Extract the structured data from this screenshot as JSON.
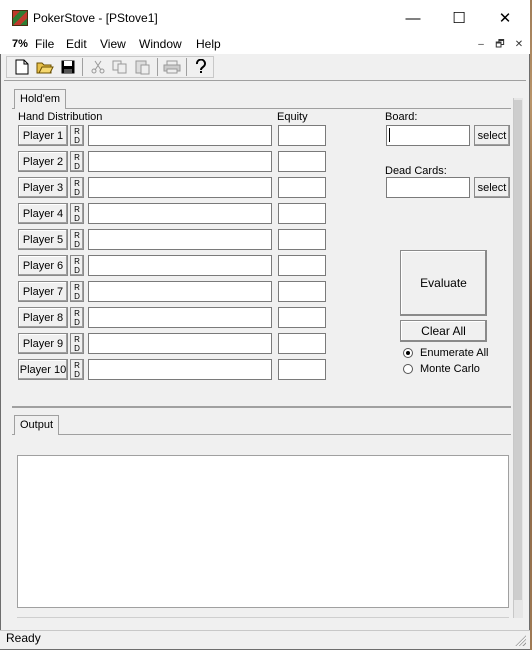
{
  "window": {
    "title": "PokerStove - [PStove1]",
    "minimize_glyph": "—",
    "maximize_glyph": "☐",
    "close_glyph": "✕"
  },
  "menu": {
    "zoom": "7%",
    "items": [
      "File",
      "Edit",
      "View",
      "Window",
      "Help"
    ],
    "mdi_min": "–",
    "mdi_restore": "🗗",
    "mdi_close": "✕"
  },
  "toolbar": {
    "icons": [
      "new-file-icon",
      "open-folder-icon",
      "save-icon",
      "cut-icon",
      "copy-icon",
      "paste-icon",
      "print-icon",
      "help-icon"
    ]
  },
  "tabs": {
    "holdem": "Hold'em",
    "output": "Output"
  },
  "labels": {
    "hand_distribution": "Hand Distribution",
    "equity": "Equity",
    "board": "Board:",
    "dead_cards": "Dead Cards:"
  },
  "players": [
    {
      "label": "Player 1",
      "rd": "R\nD",
      "hand": "",
      "equity": ""
    },
    {
      "label": "Player 2",
      "rd": "R\nD",
      "hand": "",
      "equity": ""
    },
    {
      "label": "Player 3",
      "rd": "R\nD",
      "hand": "",
      "equity": ""
    },
    {
      "label": "Player 4",
      "rd": "R\nD",
      "hand": "",
      "equity": ""
    },
    {
      "label": "Player 5",
      "rd": "R\nD",
      "hand": "",
      "equity": ""
    },
    {
      "label": "Player 6",
      "rd": "R\nD",
      "hand": "",
      "equity": ""
    },
    {
      "label": "Player 7",
      "rd": "R\nD",
      "hand": "",
      "equity": ""
    },
    {
      "label": "Player 8",
      "rd": "R\nD",
      "hand": "",
      "equity": ""
    },
    {
      "label": "Player 9",
      "rd": "R\nD",
      "hand": "",
      "equity": ""
    },
    {
      "label": "Player 10",
      "rd": "R\nD",
      "hand": "",
      "equity": ""
    }
  ],
  "board": {
    "value": "",
    "select_label": "select"
  },
  "dead": {
    "value": "",
    "select_label": "select"
  },
  "buttons": {
    "evaluate": "Evaluate",
    "clear_all": "Clear All"
  },
  "mode": {
    "enumerate_all": "Enumerate All",
    "monte_carlo": "Monte Carlo",
    "selected": "enumerate_all"
  },
  "output": {
    "text": ""
  },
  "status": {
    "text": "Ready"
  }
}
